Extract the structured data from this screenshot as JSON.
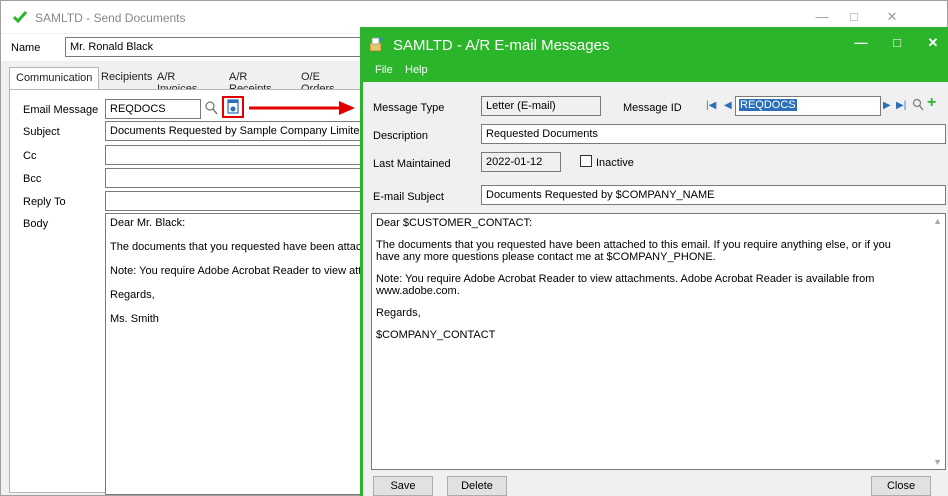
{
  "bg": {
    "title": "SAMLTD - Send Documents",
    "name_label": "Name",
    "name_value": "Mr. Ronald Black",
    "tabs": [
      "Communication",
      "Recipients",
      "A/R Invoices",
      "A/R Receipts",
      "O/E Orders"
    ],
    "email_message_label": "Email Message",
    "email_message_value": "REQDOCS",
    "subject_label": "Subject",
    "subject_value": "Documents Requested by Sample Company Limited",
    "cc_label": "Cc",
    "bcc_label": "Bcc",
    "reply_to_label": "Reply To",
    "body_label": "Body",
    "body_lines": [
      "Dear Mr. Black:",
      "The documents that you requested have been attached to",
      "Note: You require Adobe Acrobat Reader to view attachme",
      "Regards,",
      "Ms. Smith"
    ]
  },
  "fg": {
    "title": "SAMLTD - A/R E-mail Messages",
    "menu": [
      "File",
      "Help"
    ],
    "message_type_label": "Message Type",
    "message_type_value": "Letter (E-mail)",
    "message_id_label": "Message ID",
    "message_id_value": "REQDOCS",
    "description_label": "Description",
    "description_value": "Requested Documents",
    "last_maintained_label": "Last Maintained",
    "last_maintained_value": "2022-01-12",
    "inactive_label": "Inactive",
    "subject_label": "E-mail Subject",
    "subject_value": "Documents Requested by $COMPANY_NAME",
    "body_paragraphs": [
      "Dear $CUSTOMER_CONTACT:",
      "The documents that you requested have been attached to this email. If you require anything else, or if you have any more questions please contact me at $COMPANY_PHONE.",
      "Note: You require Adobe Acrobat Reader to view attachments. Adobe Acrobat Reader is available from www.adobe.com.",
      "Regards,",
      "$COMPANY_CONTACT"
    ],
    "save_label": "Save",
    "delete_label": "Delete",
    "close_label": "Close"
  },
  "colors": {
    "accent_green": "#2ab52a",
    "arrow_red": "#e00000"
  },
  "icons": [
    "app-icon",
    "minimize-icon",
    "maximize-icon",
    "close-icon",
    "search-icon",
    "document-icon",
    "first-record-icon",
    "previous-record-icon",
    "next-record-icon",
    "last-record-icon",
    "add-icon"
  ]
}
